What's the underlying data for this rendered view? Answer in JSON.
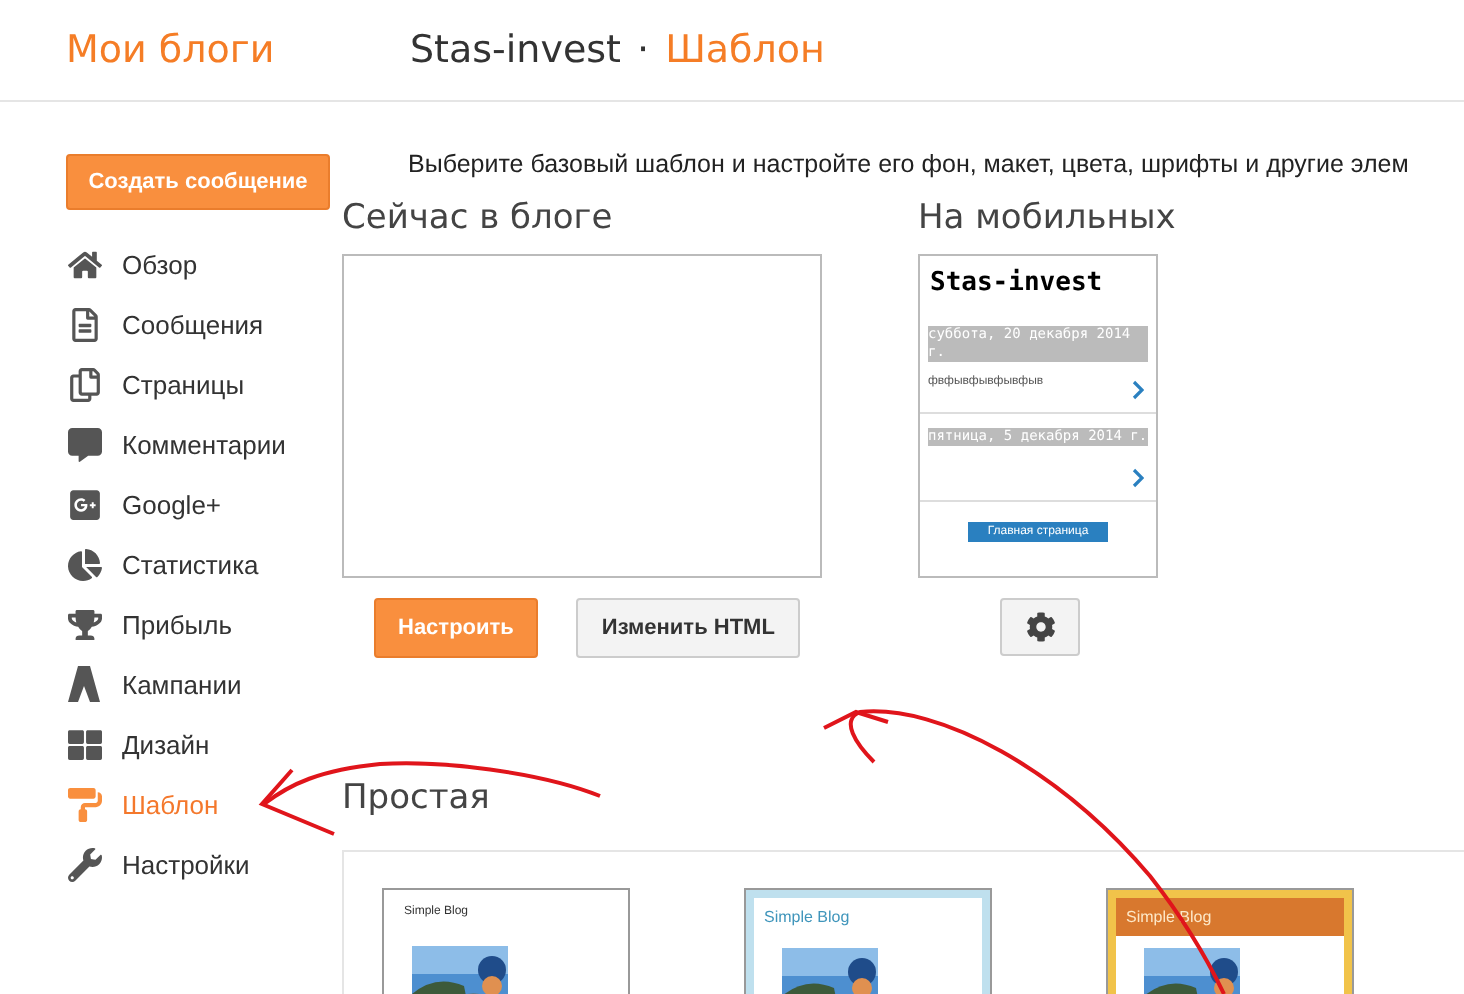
{
  "header": {
    "app_title": "Мои блоги",
    "blog_name": "Stas-invest",
    "separator": "·",
    "section": "Шаблон"
  },
  "sidebar": {
    "new_post_button": "Создать сообщение",
    "items": [
      {
        "label": "Обзор",
        "selected": false
      },
      {
        "label": "Сообщения",
        "selected": false
      },
      {
        "label": "Страницы",
        "selected": false
      },
      {
        "label": "Комментарии",
        "selected": false
      },
      {
        "label": "Google+",
        "selected": false
      },
      {
        "label": "Статистика",
        "selected": false
      },
      {
        "label": "Прибыль",
        "selected": false
      },
      {
        "label": "Кампании",
        "selected": false
      },
      {
        "label": "Дизайн",
        "selected": false
      },
      {
        "label": "Шаблон",
        "selected": true
      },
      {
        "label": "Настройки",
        "selected": false
      }
    ]
  },
  "description": "Выберите базовый шаблон и настройте его фон, макет, цвета, шрифты и другие элем",
  "current": {
    "title": "Сейчас в блоге",
    "buttons": [
      {
        "label": "Настроить",
        "kind": "primary"
      },
      {
        "label": "Изменить HTML",
        "kind": "secondary"
      }
    ]
  },
  "mobile": {
    "title": "На мобильных",
    "blog_title": "Stas-invest",
    "posts": [
      {
        "date": "суббота, 20 декабря 2014 г.",
        "snippet": "фвфывфывфывфыв"
      },
      {
        "date": "пятница, 5 декабря 2014 г."
      }
    ],
    "home_button": "Главная страница"
  },
  "simple": {
    "title": "Простая",
    "templates": [
      {
        "name": "Simple Blog",
        "kind": "white"
      },
      {
        "name": "Simple Blog",
        "kind": "blue"
      },
      {
        "name": "Simple Blog",
        "kind": "orange"
      }
    ]
  }
}
